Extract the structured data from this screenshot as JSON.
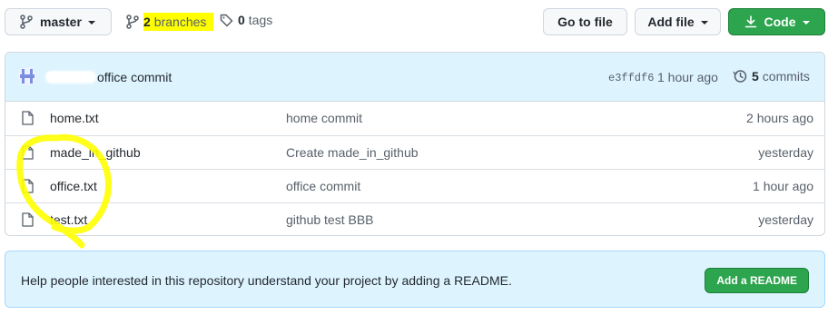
{
  "toolbar": {
    "branch_label": "master",
    "branches_count": "2",
    "branches_label": "branches",
    "tags_count": "0",
    "tags_label": "tags",
    "go_to_file": "Go to file",
    "add_file": "Add file",
    "code": "Code"
  },
  "latest_commit": {
    "message": "office commit",
    "sha": "e3ffdf6",
    "age": "1 hour ago",
    "commits_count": "5",
    "commits_label": "commits"
  },
  "files": [
    {
      "name": "home.txt",
      "message": "home commit",
      "age": "2 hours ago"
    },
    {
      "name": "made_in_github",
      "message": "Create made_in_github",
      "age": "yesterday"
    },
    {
      "name": "office.txt",
      "message": "office commit",
      "age": "1 hour ago"
    },
    {
      "name": "test.txt",
      "message": "github test BBB",
      "age": "yesterday"
    }
  ],
  "readme_banner": {
    "text": "Help people interested in this repository understand your project by adding a README.",
    "button": "Add a README"
  },
  "colors": {
    "accent_green": "#2da44e",
    "header_blue": "#ddf4ff",
    "annotation_yellow": "#ffff00"
  }
}
